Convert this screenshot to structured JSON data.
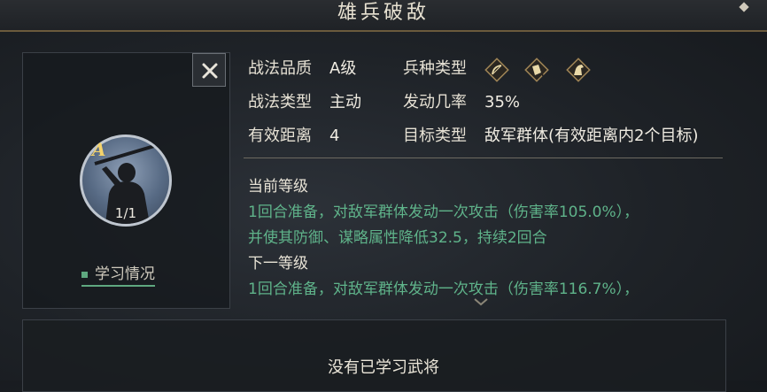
{
  "window": {
    "title": "雄兵破敌"
  },
  "tactic": {
    "quality_label": "战法品质",
    "quality_value": "A级",
    "type_label": "战法类型",
    "type_value": "主动",
    "range_label": "有效距离",
    "range_value": "4",
    "troop_label": "兵种类型",
    "troop_icons": [
      "bow-icon",
      "shield-icon",
      "horse-icon"
    ],
    "rate_label": "发动几率",
    "rate_value": "35%",
    "target_label": "目标类型",
    "target_value": "敌军群体(有效距离内2个目标)"
  },
  "avatar": {
    "grade": "A",
    "count": "1/1"
  },
  "study_status": "学习情况",
  "current_level": {
    "heading": "当前等级",
    "lines": [
      "1回合准备，对敌军群体发动一次攻击（伤害率105.0%），",
      "并使其防御、谋略属性降低32.5，持续2回合"
    ]
  },
  "next_level": {
    "heading": "下一等级",
    "lines": [
      "1回合准备，对敌军群体发动一次攻击（伤害率116.7%），"
    ]
  },
  "generals": {
    "empty_text": "没有已学习武将"
  },
  "colors": {
    "accent_green": "#5fb38a",
    "gold_border": "#a08556",
    "grade_gold": "#f4d36b"
  }
}
